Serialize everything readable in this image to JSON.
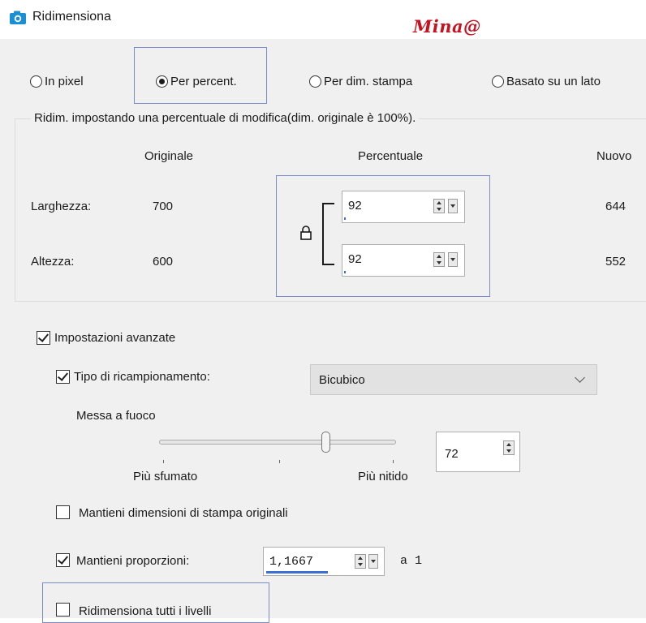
{
  "window": {
    "title": "Ridimensiona",
    "watermark": "Mina@",
    "icon": "camera-icon"
  },
  "resize_mode": {
    "options": [
      {
        "label": "In pixel",
        "selected": false
      },
      {
        "label": "Per percent.",
        "selected": true
      },
      {
        "label": "Per dim. stampa",
        "selected": false
      },
      {
        "label": "Basato su un lato",
        "selected": false
      }
    ]
  },
  "percent_group": {
    "legend": "Ridim. impostando una percentuale di modifica(dim. originale è 100%).",
    "col_original": "Originale",
    "col_percent": "Percentuale",
    "col_new": "Nuovo",
    "rows": [
      {
        "label": "Larghezza:",
        "original": "700",
        "percent": "92",
        "new": "644"
      },
      {
        "label": "Altezza:",
        "original": "600",
        "percent": "92",
        "new": "552"
      }
    ],
    "lock_icon": "lock-icon"
  },
  "advanced": {
    "label": "Impostazioni avanzate",
    "checked": true,
    "resample": {
      "label": "Tipo di ricampionamento:",
      "checked": true,
      "selected": "Bicubico"
    },
    "sharpen": {
      "label": "Messa a fuoco",
      "value": "72",
      "level": 72,
      "min_label": "Più sfumato",
      "max_label": "Più nitido"
    },
    "keep_print_size": {
      "label": "Mantieni dimensioni di stampa originali",
      "checked": false
    },
    "keep_ratio": {
      "label": "Mantieni proporzioni:",
      "checked": true,
      "value": "1,1667",
      "suffix": "a 1"
    },
    "resize_all_layers": {
      "label": "Ridimensiona tutti i livelli",
      "checked": false
    }
  },
  "colors": {
    "panel_bg": "#f0f0f0",
    "focus_border": "#7b8ccc",
    "watermark": "#c8101e",
    "accent": "#3b6fd4"
  }
}
